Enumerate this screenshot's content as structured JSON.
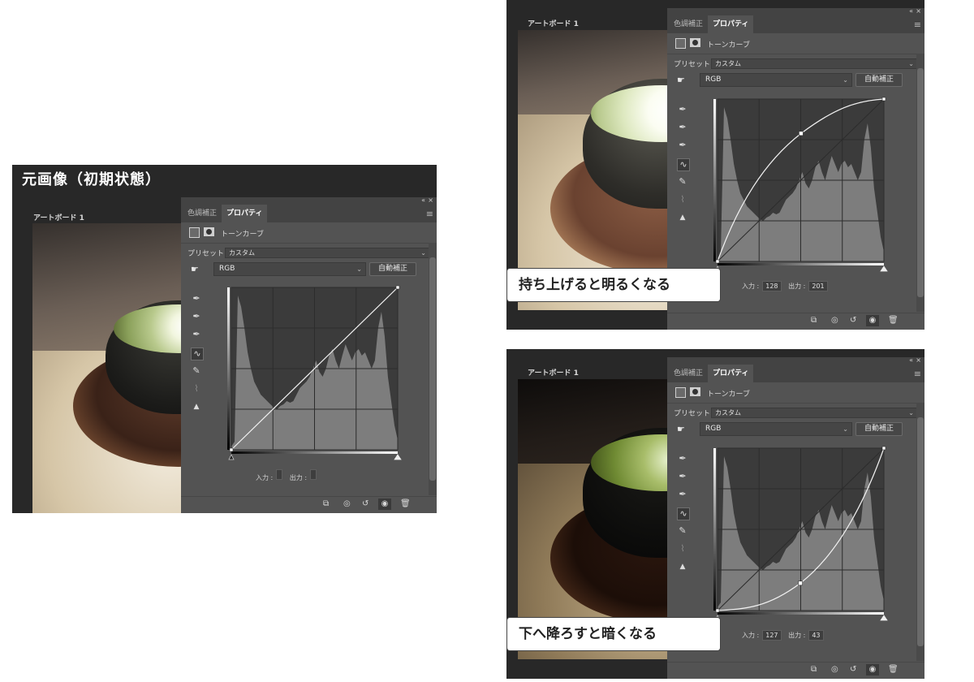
{
  "heading_original": "元画像（初期状態）",
  "artboard_label": "アートボード 1",
  "panel": {
    "collapse_glyph": "«",
    "close_glyph": "×",
    "tab_adjustments": "色調補正",
    "tab_properties": "プロパティ",
    "menu_glyph": "≡",
    "layer_type": "トーンカーブ",
    "preset_label": "プリセット :",
    "preset_value": "カスタム",
    "channel_value": "RGB",
    "auto_button": "自動補正",
    "input_label": "入力 :",
    "output_label": "出力 :"
  },
  "screens": [
    {
      "id": "original",
      "input_value": "",
      "output_value": "",
      "curve_type": "linear"
    },
    {
      "id": "brighter",
      "input_value": "128",
      "output_value": "201",
      "curve_type": "raise",
      "callout": "持ち上げると明るくなる"
    },
    {
      "id": "darker",
      "input_value": "127",
      "output_value": "43",
      "curve_type": "lower",
      "callout": "下へ降ろすと暗くなる"
    }
  ],
  "histogram_levels": [
    0.02,
    0.05,
    0.95,
    0.88,
    0.75,
    0.6,
    0.5,
    0.42,
    0.38,
    0.34,
    0.32,
    0.3,
    0.28,
    0.26,
    0.25,
    0.27,
    0.28,
    0.3,
    0.29,
    0.3,
    0.34,
    0.38,
    0.4,
    0.42,
    0.45,
    0.5,
    0.55,
    0.48,
    0.45,
    0.5,
    0.58,
    0.62,
    0.55,
    0.5,
    0.58,
    0.65,
    0.6,
    0.55,
    0.6,
    0.62,
    0.58,
    0.6,
    0.55,
    0.5,
    0.55,
    0.75,
    0.85,
    0.7,
    0.45,
    0.3,
    0.15,
    0.06
  ]
}
